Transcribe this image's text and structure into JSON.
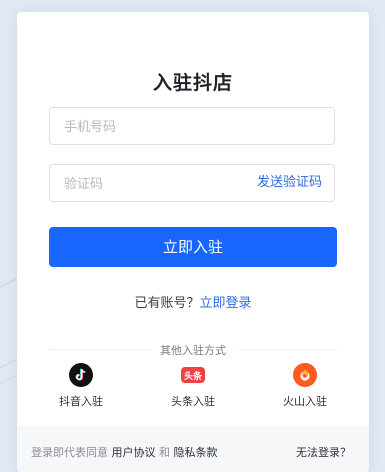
{
  "page": {
    "title": "入驻抖店"
  },
  "form": {
    "phone_placeholder": "手机号码",
    "code_placeholder": "验证码",
    "send_code_label": "发送验证码",
    "submit_label": "立即入驻"
  },
  "login_prompt": {
    "question": "已有账号？",
    "link_label": "立即登录"
  },
  "other_methods": {
    "heading": "其他入驻方式",
    "items": [
      {
        "label": "抖音入驻",
        "icon": "douyin-icon",
        "color": "#111111"
      },
      {
        "label": "头条入驻",
        "icon": "toutiao-icon",
        "color": "#f04142",
        "badge": "头条"
      },
      {
        "label": "火山入驻",
        "icon": "huoshan-icon",
        "color": "#ff5a1f"
      }
    ]
  },
  "footer": {
    "agreement_prefix": "登录即代表同意",
    "user_agreement": "用户协议",
    "and": "和",
    "privacy_policy": "隐私条款",
    "cant_login": "无法登录？"
  },
  "colors": {
    "primary": "#1966ff",
    "link": "#2d6ae0",
    "background": "#dfe8f3"
  }
}
